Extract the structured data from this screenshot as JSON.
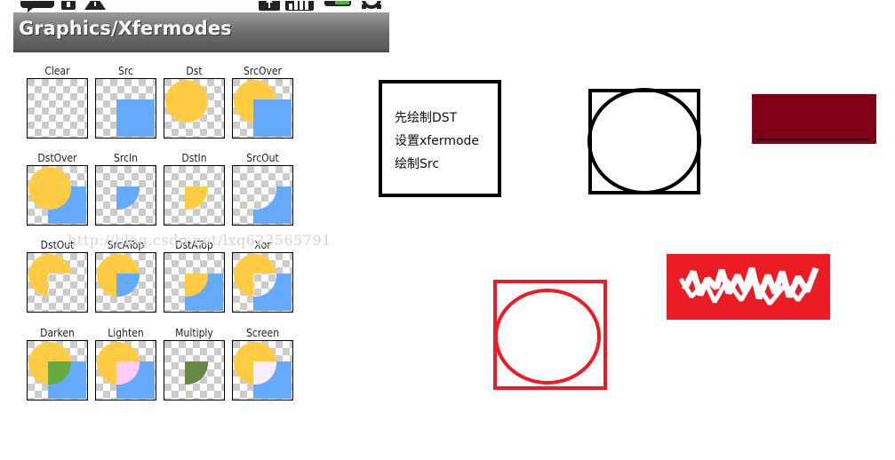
{
  "app": {
    "title": "Graphics/Xfermodes"
  },
  "status_icons": [
    "chat-icon",
    "lock-icon",
    "warning-icon",
    "usb-icon",
    "signal-icon",
    "battery-icon",
    "settings-icon"
  ],
  "modes": [
    {
      "label": "Clear",
      "mode": "clear"
    },
    {
      "label": "Src",
      "mode": "src"
    },
    {
      "label": "Dst",
      "mode": "dst"
    },
    {
      "label": "SrcOver",
      "mode": "srcover"
    },
    {
      "label": "DstOver",
      "mode": "dstover"
    },
    {
      "label": "SrcIn",
      "mode": "srcin"
    },
    {
      "label": "DstIn",
      "mode": "dstin"
    },
    {
      "label": "SrcOut",
      "mode": "srcout"
    },
    {
      "label": "DstOut",
      "mode": "dstout"
    },
    {
      "label": "SrcATop",
      "mode": "srcatop"
    },
    {
      "label": "DstATop",
      "mode": "dstatop"
    },
    {
      "label": "Xor",
      "mode": "xor"
    },
    {
      "label": "Darken",
      "mode": "darken"
    },
    {
      "label": "Lighten",
      "mode": "lighten"
    },
    {
      "label": "Multiply",
      "mode": "multiply"
    },
    {
      "label": "Screen",
      "mode": "screen"
    }
  ],
  "colors": {
    "dst_circle": "#ffcc44",
    "src_square": "#66aaff",
    "darken": "#66aa44",
    "lighten": "#ffccff",
    "multiply": "#668844",
    "screen": "#ffeeff",
    "dark_red": "#800018",
    "bright_red": "#ec1c24"
  },
  "watermark": "http://blog.csdn.net/lxq623565791",
  "annotation": {
    "line1": "先绘制DST",
    "line2": "设置xfermode",
    "line3": "绘制Src"
  }
}
